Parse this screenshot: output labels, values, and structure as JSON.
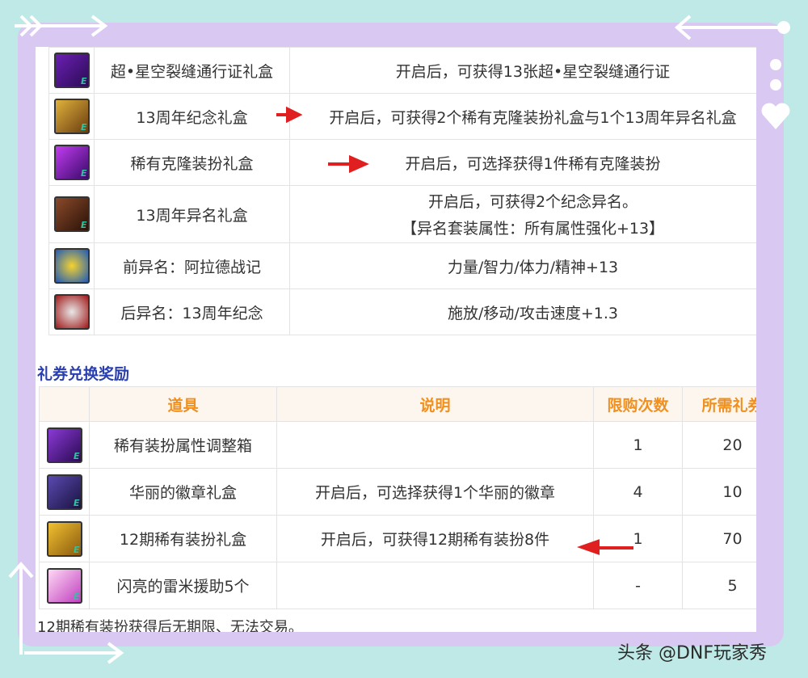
{
  "table1": {
    "rows": [
      {
        "icon": "box-icon",
        "name": "超•星空裂缝通行证礼盒",
        "desc": "开启后，可获得13张超•星空裂缝通行证"
      },
      {
        "icon": "gift-icon",
        "name": "13周年纪念礼盒",
        "desc": "开启后，可获得2个稀有克隆装扮礼盒与1个13周年异名礼盒"
      },
      {
        "icon": "costume-icon",
        "name": "稀有克隆装扮礼盒",
        "desc": "开启后，可选择获得1件稀有克隆装扮"
      },
      {
        "icon": "chest-icon",
        "name": "13周年异名礼盒",
        "desc": "开启后，可获得2个纪念异名。",
        "desc2": "【异名套装属性：所有属性强化+13】"
      },
      {
        "icon": "title-icon",
        "name": "前异名：阿拉德战记",
        "desc": "力量/智力/体力/精神+13"
      },
      {
        "icon": "title-icon",
        "name": "后异名：13周年纪念",
        "desc": "施放/移动/攻击速度+1.3"
      }
    ]
  },
  "section_title": "礼券兑换奖励",
  "table2": {
    "headers": [
      "道具",
      "说明",
      "限购次数",
      "所需礼券"
    ],
    "rows": [
      {
        "icon": "box-icon",
        "name": "稀有装扮属性调整箱",
        "desc": "",
        "limit": "1",
        "cost": "20"
      },
      {
        "icon": "badge-box-icon",
        "name": "华丽的徽章礼盒",
        "desc": "开启后，可选择获得1个华丽的徽章",
        "limit": "4",
        "cost": "10"
      },
      {
        "icon": "chest-icon",
        "name": "12期稀有装扮礼盒",
        "desc": "开启后，可获得12期稀有装扮8件",
        "limit": "1",
        "cost": "70"
      },
      {
        "icon": "crystal-icon",
        "name": "闪亮的雷米援助5个",
        "desc": "",
        "limit": "-",
        "cost": "5"
      }
    ]
  },
  "footnote": "12期稀有装扮获得后无期限、无法交易。",
  "watermark": "头条 @DNF玩家秀",
  "colors": {
    "header_orange": "#f09020",
    "title_blue": "#2a3fb0",
    "arrow_red": "#e02020",
    "frame_purple": "#d9c9f2",
    "bg_teal": "#bfe9e6"
  }
}
